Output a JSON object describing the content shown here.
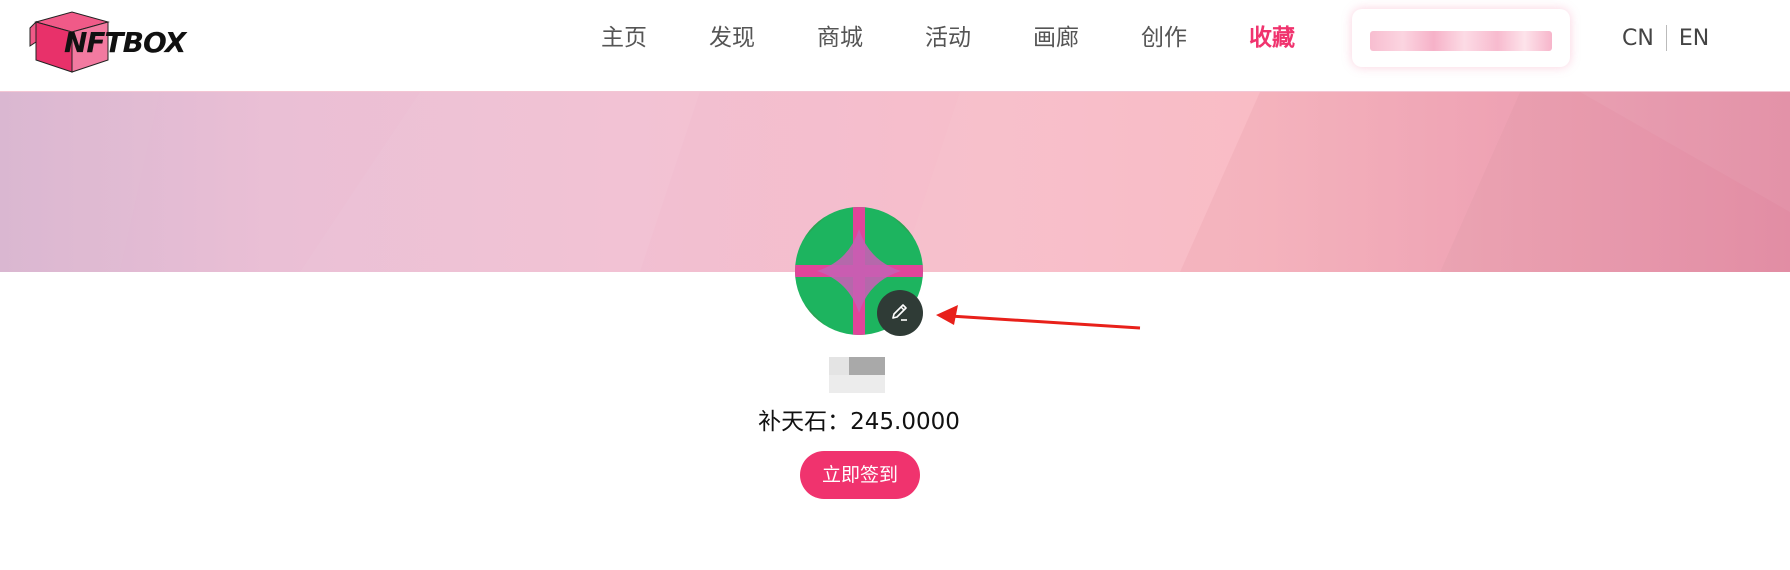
{
  "brand": {
    "name": "NFTBOX",
    "accent": "#f0336e"
  },
  "nav": {
    "items": [
      {
        "label": "主页"
      },
      {
        "label": "发现"
      },
      {
        "label": "商城"
      },
      {
        "label": "活动"
      },
      {
        "label": "画廊"
      },
      {
        "label": "创作"
      },
      {
        "label": "收藏"
      }
    ],
    "active_label": "收藏"
  },
  "search": {
    "value": ""
  },
  "language": {
    "cn": "CN",
    "en": "EN"
  },
  "profile": {
    "edit_icon": "pencil-icon",
    "stones_label": "补天石：",
    "stones_value": "245.0000",
    "checkin_label": "立即签到"
  }
}
